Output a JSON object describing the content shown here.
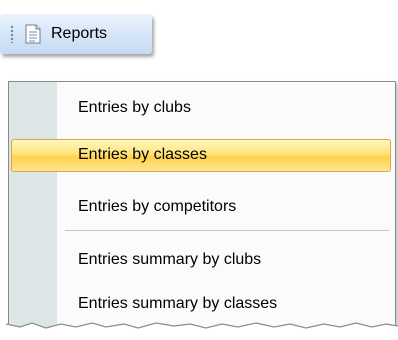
{
  "toolbar": {
    "reports_label": "Reports",
    "icon": "document-icon"
  },
  "menu": {
    "items": [
      {
        "label": "Entries by clubs",
        "highlighted": false
      },
      {
        "label": "Entries by classes",
        "highlighted": true
      },
      {
        "label": "Entries by competitors",
        "highlighted": false
      },
      {
        "label": "Entries summary by clubs",
        "highlighted": false
      },
      {
        "label": "Entries summary by classes",
        "highlighted": false
      }
    ]
  },
  "colors": {
    "toolbar_bg": "#c4daf3",
    "menu_gutter": "#dde6e6",
    "highlight": "#ffd24a",
    "highlight_border": "#e0a53b"
  }
}
